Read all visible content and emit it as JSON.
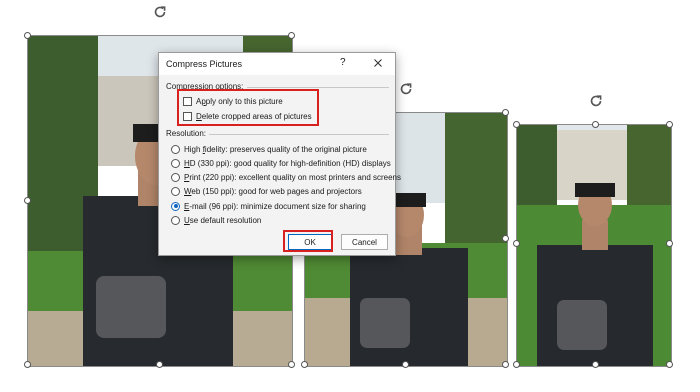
{
  "dialog": {
    "title": "Compress Pictures",
    "help_glyph": "?",
    "compression_label": "Compression options:",
    "options": {
      "apply_only_pre": "A",
      "apply_only_ul": "p",
      "apply_only_post": "ply only to this picture",
      "delete_cropped_ul": "D",
      "delete_cropped_post": "elete cropped areas of pictures"
    },
    "resolution_label": "Resolution:",
    "resolutions": [
      {
        "pre": "High ",
        "ul": "f",
        "post": "idelity: preserves quality of the original picture",
        "selected": false
      },
      {
        "pre": "",
        "ul": "H",
        "post": "D (330 ppi): good quality for high-definition (HD) displays",
        "selected": false
      },
      {
        "pre": "",
        "ul": "P",
        "post": "rint (220 ppi): excellent quality on most printers and screens",
        "selected": false
      },
      {
        "pre": "",
        "ul": "W",
        "post": "eb (150 ppi): good for web pages and projectors",
        "selected": false
      },
      {
        "pre": "",
        "ul": "E",
        "post": "-mail (96 ppi): minimize document size for sharing",
        "selected": true
      },
      {
        "pre": "",
        "ul": "U",
        "post": "se default resolution",
        "selected": false
      }
    ],
    "ok_label": "OK",
    "cancel_label": "Cancel"
  },
  "colors": {
    "highlight": "#d8201f",
    "accent": "#1565c0"
  }
}
